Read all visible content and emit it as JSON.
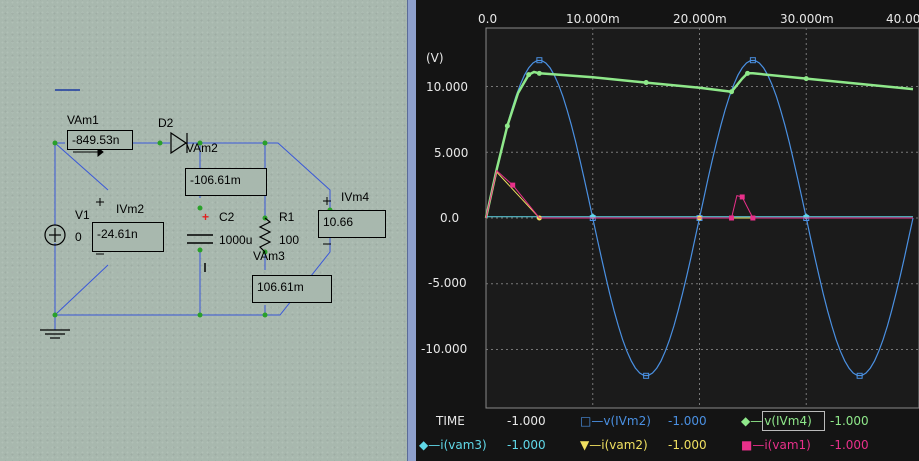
{
  "schematic": {
    "components": {
      "vam1": {
        "name": "VAm1",
        "value": "-849.53n"
      },
      "d2": {
        "name": "D2"
      },
      "vam2": {
        "name": "VAm2",
        "value": "-106.61m"
      },
      "v1": {
        "name": "V1",
        "value": "0"
      },
      "ivm2": {
        "name": "IVm2",
        "value": "-24.61n"
      },
      "c2": {
        "name": "C2",
        "value": "1000u"
      },
      "r1": {
        "name": "R1",
        "value": "100"
      },
      "vam3": {
        "name": "VAm3",
        "value": "106.61m"
      },
      "ivm4": {
        "name": "IVm4",
        "value": "10.66"
      }
    },
    "plus_sign": "+"
  },
  "scope": {
    "unit_label": "(V)",
    "x_ticks": [
      "0.0",
      "10.000m",
      "20.000m",
      "30.000m",
      "40.00"
    ],
    "y_ticks": [
      "10.000",
      "5.000",
      "0.0",
      "-5.000",
      "-10.000"
    ],
    "legend_row1": {
      "time_label": "TIME",
      "time_value": "-1.000",
      "s1_name": "v(IVm2)",
      "s1_value": "-1.000",
      "s2_name": "v(IVm4)",
      "s2_value": "-1.000"
    },
    "legend_row2": {
      "s3_name": "i(vam3)",
      "s3_value": "-1.000",
      "s4_name": "i(vam2)",
      "s4_value": "-1.000",
      "s5_name": "i(vam1)",
      "s5_value": "-1.000"
    },
    "colors": {
      "ivm2": "#4a90e2",
      "ivm4": "#8fe88a",
      "vam3": "#60d8e8",
      "vam2": "#f0e060",
      "vam1": "#e8308a",
      "background": "#141414",
      "plot_bg": "#1b1b1b"
    }
  },
  "chart_data": {
    "type": "line",
    "x_unit": "s",
    "xlim": [
      0,
      0.04
    ],
    "ylim": [
      -12,
      12
    ],
    "ylabel": "(V)",
    "series": [
      {
        "name": "v(IVm2)",
        "x": [
          0,
          0.0025,
          0.005,
          0.0075,
          0.01,
          0.0125,
          0.015,
          0.0175,
          0.02,
          0.0225,
          0.025,
          0.0275,
          0.03,
          0.0325,
          0.035,
          0.0375,
          0.04
        ],
        "y": [
          0,
          8.5,
          12,
          8.5,
          0,
          -8.5,
          -12,
          -8.5,
          0,
          8.5,
          12,
          8.5,
          0,
          -8.5,
          -12,
          -8.5,
          0
        ]
      },
      {
        "name": "v(IVm4)",
        "x": [
          0,
          0.001,
          0.002,
          0.003,
          0.004,
          0.0045,
          0.005,
          0.01,
          0.015,
          0.02,
          0.023,
          0.024,
          0.0245,
          0.025,
          0.03,
          0.035,
          0.04
        ],
        "y": [
          0,
          3.7,
          7.0,
          9.5,
          10.9,
          11.1,
          11.0,
          10.7,
          10.3,
          9.9,
          9.6,
          10.6,
          11.0,
          11.0,
          10.6,
          10.2,
          9.8
        ]
      },
      {
        "name": "i(vam3)",
        "x": [
          0,
          0.005,
          0.01,
          0.02,
          0.03,
          0.04
        ],
        "y": [
          0.1,
          0.1,
          0.1,
          0.1,
          0.1,
          0.1
        ]
      },
      {
        "name": "i(vam2)",
        "x": [
          0,
          0.001,
          0.005,
          0.01,
          0.02,
          0.03,
          0.04
        ],
        "y": [
          0,
          3.5,
          0,
          0,
          0,
          0,
          0
        ]
      },
      {
        "name": "i(vam1)",
        "x": [
          0,
          0.001,
          0.0025,
          0.005,
          0.023,
          0.0235,
          0.024,
          0.0245,
          0.025,
          0.03,
          0.04
        ],
        "y": [
          0,
          3.6,
          2.5,
          0,
          0,
          1.7,
          1.6,
          0.8,
          0,
          0,
          0
        ]
      }
    ]
  }
}
